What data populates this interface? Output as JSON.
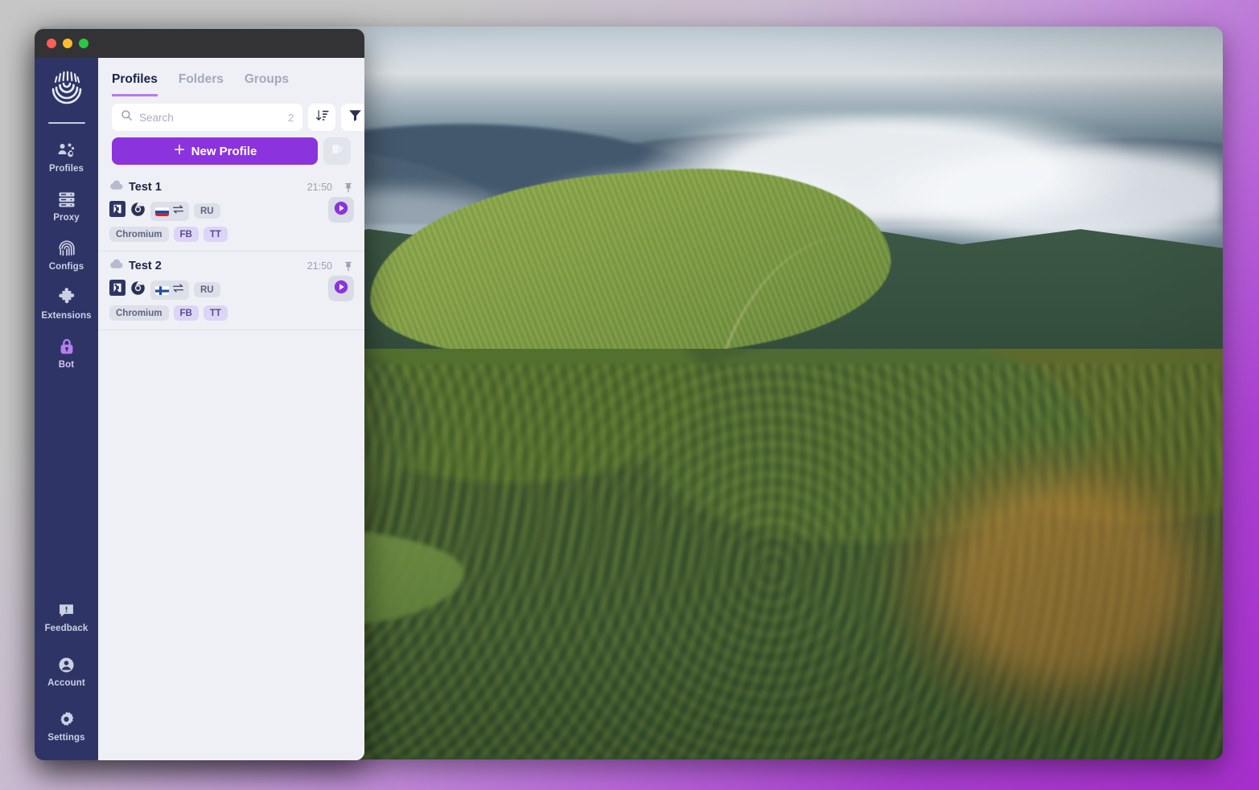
{
  "window": {
    "traffic_lights": [
      "close",
      "minimize",
      "maximize"
    ]
  },
  "sidebar": {
    "logo_name": "undetectable-logo",
    "items": [
      {
        "label": "Profiles",
        "icon": "profiles-icon",
        "active": false
      },
      {
        "label": "Proxy",
        "icon": "proxy-icon",
        "active": false
      },
      {
        "label": "Configs",
        "icon": "fingerprint-icon",
        "active": false
      },
      {
        "label": "Extensions",
        "icon": "puzzle-icon",
        "active": false
      },
      {
        "label": "Bot",
        "icon": "lock-icon",
        "active": true
      }
    ],
    "bottom_items": [
      {
        "label": "Feedback",
        "icon": "feedback-icon"
      },
      {
        "label": "Account",
        "icon": "account-icon"
      },
      {
        "label": "Settings",
        "icon": "gear-icon"
      }
    ]
  },
  "main": {
    "tabs": [
      {
        "label": "Profiles",
        "active": true
      },
      {
        "label": "Folders",
        "active": false
      },
      {
        "label": "Groups",
        "active": false
      }
    ],
    "search": {
      "placeholder": "Search",
      "value": "",
      "count": "2",
      "icon": "search-icon"
    },
    "sort_button": {
      "icon": "sort-descending-icon",
      "label": ""
    },
    "filter_button": {
      "icon": "filter-funnel-icon",
      "label": ""
    },
    "new_profile_button": {
      "label": "New Profile",
      "icon": "plus-icon"
    },
    "panel_toggle_button": {
      "icon": "panel-toggle-icon",
      "label": ""
    }
  },
  "profiles": [
    {
      "name": "Test 1",
      "time": "21:50",
      "status_icon": "cloud-icon",
      "pin_icon": "pin-icon",
      "os_icon": "windows-os-icon",
      "browser_icon": "chromium-browser-icon",
      "flag": "RU",
      "flag_name": "russia-flag",
      "proxy_icon": "proxy-swap-icon",
      "locale_chip": "RU",
      "tags": [
        "Chromium",
        "FB",
        "TT"
      ],
      "run_button": "play-icon"
    },
    {
      "name": "Test 2",
      "time": "21:50",
      "status_icon": "cloud-icon",
      "pin_icon": "pin-icon",
      "os_icon": "windows-os-icon",
      "browser_icon": "chromium-browser-icon",
      "flag": "FI",
      "flag_name": "finland-flag",
      "proxy_icon": "proxy-swap-icon",
      "locale_chip": "RU",
      "tags": [
        "Chromium",
        "FB",
        "TT"
      ],
      "run_button": "play-icon"
    }
  ],
  "colors": {
    "sidebar_bg": "#2e3566",
    "accent_purple": "#8b33dd",
    "tab_underline": "#b47cf0",
    "panel_bg": "#eef0f5",
    "title_bar": "#333335",
    "active_nav": "#b87ef0"
  }
}
